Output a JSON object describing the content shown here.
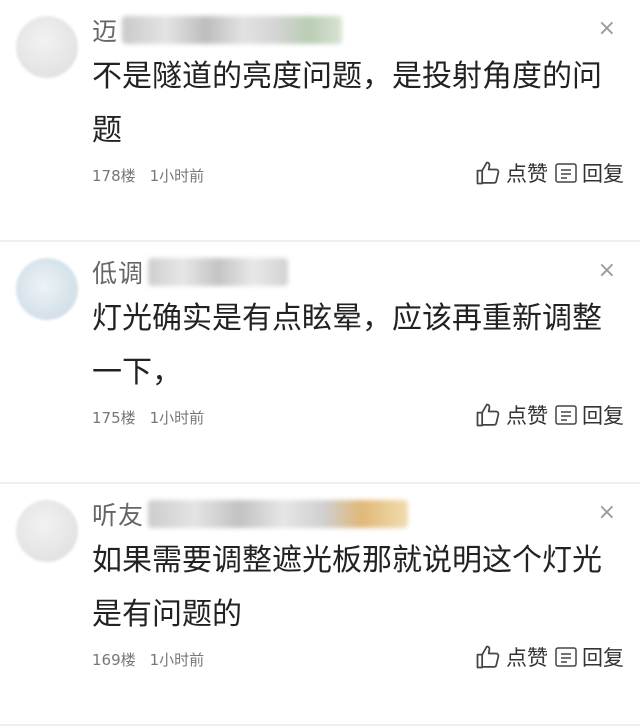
{
  "comments": [
    {
      "username": "迈",
      "text": "不是隧道的亮度问题，是投射角度的问题",
      "floor": "178楼",
      "time": "1小时前",
      "like_label": "点赞",
      "reply_label": "回复",
      "close_glyph": "×"
    },
    {
      "username": "低调",
      "text": "灯光确实是有点眩晕，应该再重新调整一下，",
      "floor": "175楼",
      "time": "1小时前",
      "like_label": "点赞",
      "reply_label": "回复",
      "close_glyph": "×"
    },
    {
      "username": "听友",
      "text": "如果需要调整遮光板那就说明这个灯光是有问题的",
      "floor": "169楼",
      "time": "1小时前",
      "like_label": "点赞",
      "reply_label": "回复",
      "close_glyph": "×"
    }
  ],
  "icons": {
    "like": "thumbs-up-icon",
    "reply": "comment-icon",
    "close": "close-icon"
  },
  "colors": {
    "text": "#222222",
    "meta": "#777777",
    "username": "#666666",
    "divider": "#eeeeee"
  }
}
